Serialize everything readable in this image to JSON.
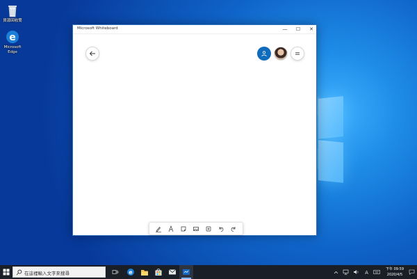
{
  "desktop": {
    "icons": [
      {
        "label": "資源回收筒",
        "icon": "recycle-bin-icon"
      },
      {
        "label": "Microsoft Edge",
        "icon": "edge-icon"
      }
    ]
  },
  "window": {
    "title": "Microsoft Whiteboard",
    "controls": {
      "minimize": "—",
      "maximize": "☐",
      "close": "✕"
    }
  },
  "whiteboard": {
    "back_icon": "arrow-left-icon",
    "invite_icon": "person-add-icon",
    "menu_icon": "hamburger-icon",
    "tools": [
      "pen-icon",
      "text-icon",
      "sticky-note-icon",
      "image-icon",
      "insert-icon",
      "undo-icon",
      "redo-icon"
    ]
  },
  "taskbar": {
    "search_placeholder": "在這裡輸入文字來搜尋",
    "apps": [
      "task-view-icon",
      "edge-icon",
      "file-explorer-icon",
      "store-icon",
      "mail-icon",
      "whiteboard-icon"
    ],
    "clock": {
      "time_prefix": "下午",
      "time": "09:59",
      "date": "2020/4/5"
    }
  },
  "colors": {
    "accent": "#0f6cbd",
    "taskbar": "#1a1f27"
  }
}
